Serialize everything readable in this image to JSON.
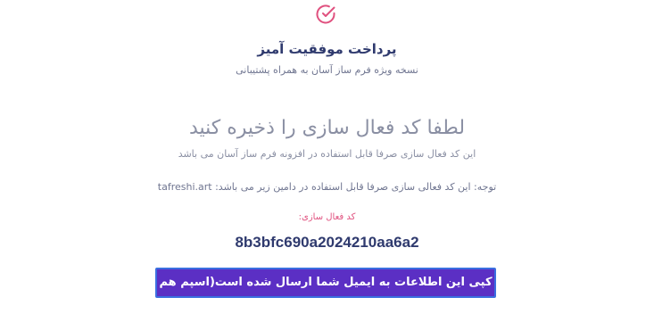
{
  "success": {
    "icon": "check-circle-icon",
    "title": "پرداخت موفقیت آمیز",
    "subtitle": "نسخه ویژه فرم ساز آسان به همراه پشتیبانی"
  },
  "activation": {
    "heading": "لطفا کد فعال سازی را ذخیره کنید",
    "description": "این کد فعال سازی صرفا قابل استفاده در افزونه فرم ساز آسان می باشد",
    "note": "توجه: این کد فعالی سازی صرفا قابل استفاده در دامین زیر می باشد: tafreshi.art",
    "code_label": "کد فعال سازی:",
    "code": "8b3bfc690a2024210aa6a2",
    "copy_button_label": "کپی این اطلاعات به ایمیل شما ارسال شده است(اسپم هم چک کنید)"
  },
  "colors": {
    "accent": "#e0517f",
    "button": "#5b2fc4",
    "title": "#2f3a6e"
  }
}
